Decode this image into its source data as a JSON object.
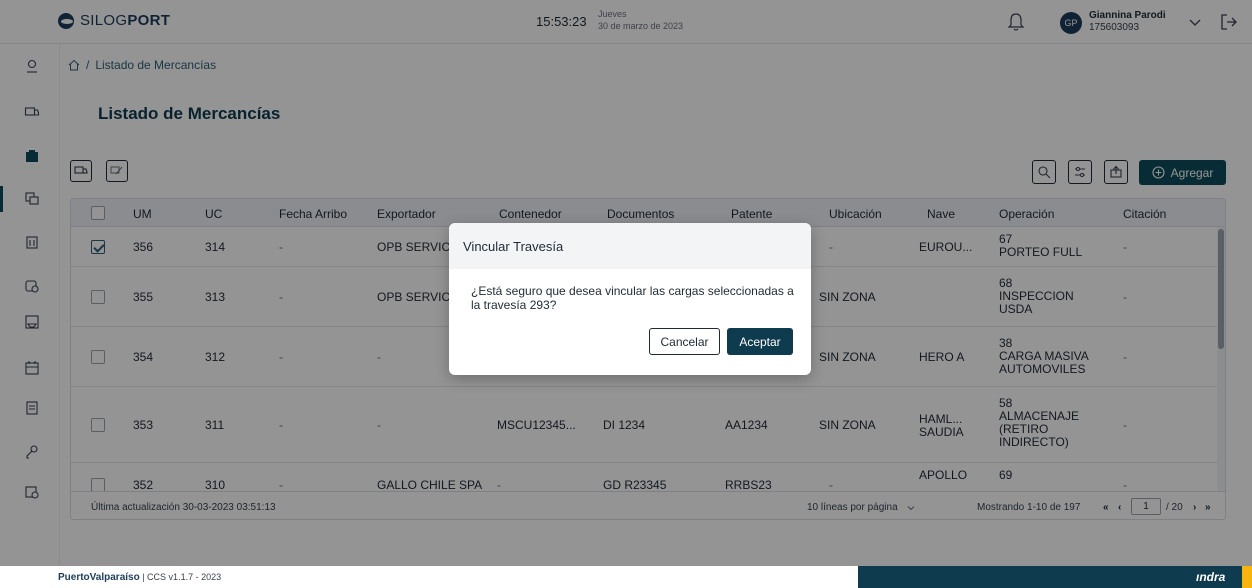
{
  "header": {
    "logo_text_light": "SILOG",
    "logo_text_bold": "PORT",
    "time": "15:53:23",
    "weekday": "Jueves",
    "date": "30 de marzo de 2023",
    "avatar_initials": "GP",
    "user_name": "Giannina Parodi",
    "user_id": "175603093"
  },
  "breadcrumb": {
    "separator": "/",
    "current": "Listado de Mercancías"
  },
  "page": {
    "title": "Listado de Mercancías",
    "add_button": "Agregar"
  },
  "table": {
    "columns": [
      "UM",
      "UC",
      "Fecha Arribo",
      "Exportador",
      "Contenedor",
      "Documentos",
      "Patente",
      "Ubicación",
      "Nave",
      "Operación",
      "Citación"
    ],
    "rows": [
      {
        "checked": true,
        "um": "356",
        "uc": "314",
        "fecha": "-",
        "exportador": "OPB SERVICIO",
        "contenedor": "",
        "documentos": "",
        "patente": "",
        "ubicacion": "-",
        "nave": "EUROU...",
        "op_code": "67",
        "op_lines": [
          "PORTEO FULL"
        ],
        "citacion": "-"
      },
      {
        "checked": false,
        "um": "355",
        "uc": "313",
        "fecha": "-",
        "exportador": "OPB SERVICIO",
        "contenedor": "",
        "documentos": "",
        "patente": "",
        "ubicacion": "SIN ZONA",
        "nave": "",
        "op_code": "68",
        "op_lines": [
          "INSPECCION",
          "USDA"
        ],
        "citacion": "-"
      },
      {
        "checked": false,
        "um": "354",
        "uc": "312",
        "fecha": "-",
        "exportador": "-",
        "contenedor": "",
        "documentos": "",
        "patente": "",
        "ubicacion": "SIN ZONA",
        "nave": "HERO A",
        "op_code": "38",
        "op_lines": [
          "CARGA MASIVA",
          "AUTOMOVILES"
        ],
        "citacion": "-"
      },
      {
        "checked": false,
        "um": "353",
        "uc": "311",
        "fecha": "-",
        "exportador": "-",
        "contenedor": "MSCU12345...",
        "documentos": "DI 1234",
        "patente": "AA1234",
        "ubicacion": "SIN ZONA",
        "nave": "HAML...\nSAUDIA",
        "op_code": "58",
        "op_lines": [
          "ALMACENAJE",
          "(RETIRO",
          "INDIRECTO)"
        ],
        "citacion": "-"
      },
      {
        "checked": false,
        "um": "352",
        "uc": "310",
        "fecha": "-",
        "exportador": "GALLO CHILE SPA",
        "contenedor": "-",
        "documentos": "GD R23345",
        "patente": "RRBS23",
        "ubicacion": "-",
        "nave": "APOLLO",
        "op_code": "69",
        "op_lines": [],
        "citacion": "-"
      }
    ]
  },
  "footer": {
    "last_update": "Última actualización 30-03-2023 03:51:13",
    "lines_per_page": "10 líneas por página",
    "showing": "Mostrando 1-10 de 197",
    "page_current": "1",
    "page_total": "/ 20"
  },
  "modal": {
    "title": "Vincular Travesía",
    "message": "¿Está seguro que desea vincular las cargas seleccionadas a la travesía 293?",
    "cancel": "Cancelar",
    "accept": "Aceptar"
  },
  "bottom": {
    "brand": "PuertoValparaíso",
    "version": "| CCS v1.1.7 - 2023",
    "partner": "ındra"
  },
  "colors": {
    "primary": "#0f3b4e",
    "accent": "#f6b40e",
    "overlay": "rgba(0,0,0,0.42)"
  }
}
